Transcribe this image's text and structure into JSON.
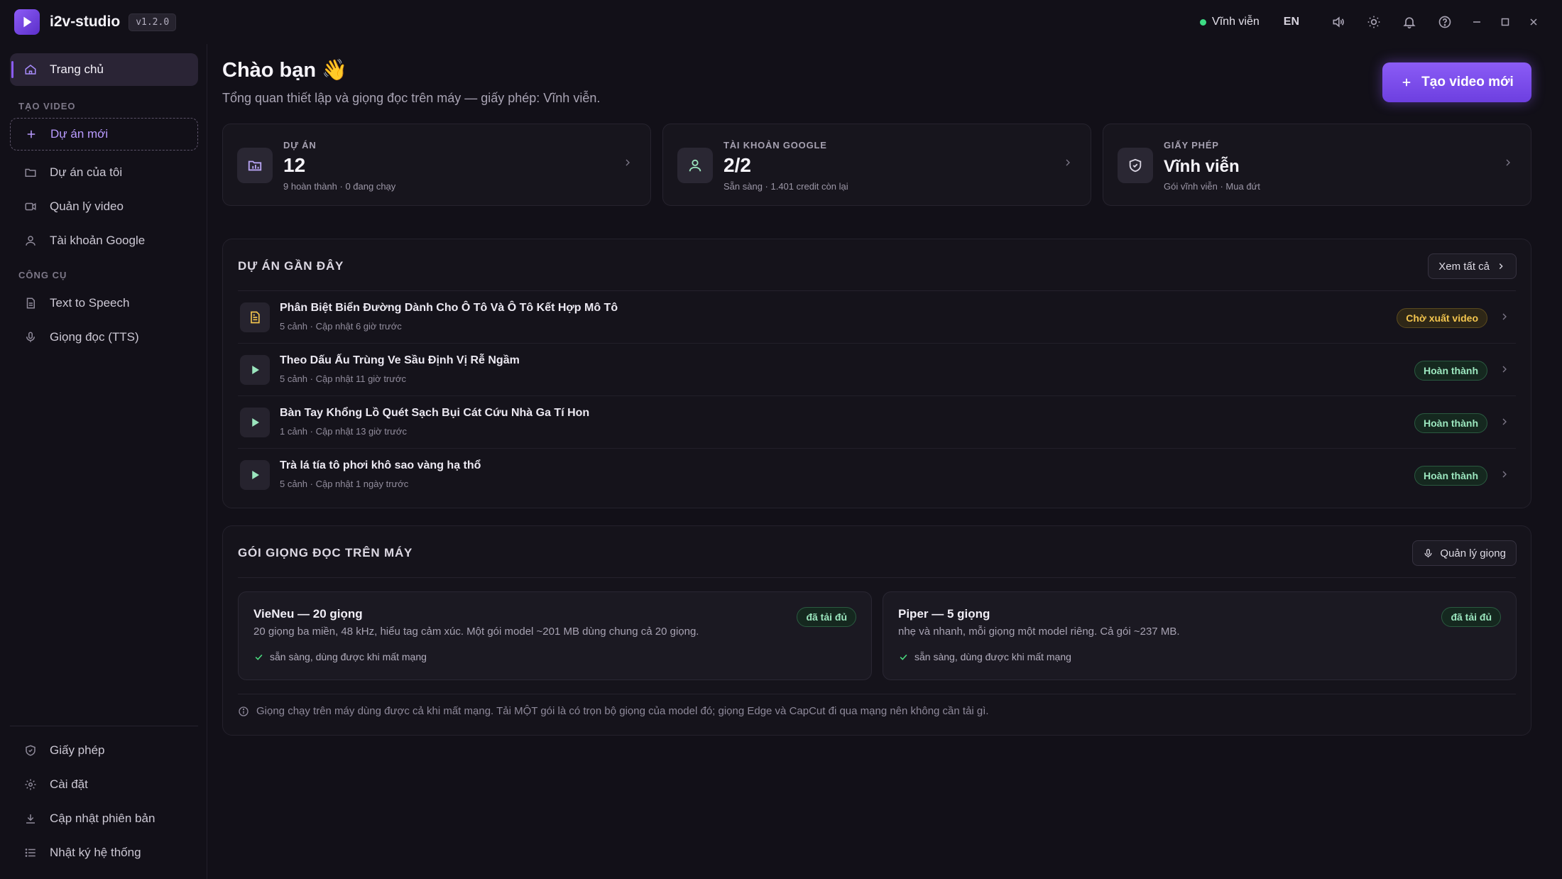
{
  "app": {
    "name": "i2v-studio",
    "version": "v1.2.0"
  },
  "titlebar": {
    "license_status": "Vĩnh viễn",
    "language": "EN",
    "icons": [
      "volume-icon",
      "theme-icon",
      "bell-icon",
      "help-icon",
      "minimize-icon",
      "maximize-icon",
      "close-icon"
    ]
  },
  "sidebar": {
    "home": "Trang chủ",
    "section_create": "TẠO VIDEO",
    "new_project": "Dự án mới",
    "my_projects": "Dự án của tôi",
    "manage_video": "Quản lý video",
    "google_account": "Tài khoản Google",
    "section_tools": "CÔNG CỤ",
    "text_to_speech": "Text to Speech",
    "tts_voice": "Giọng đọc (TTS)",
    "license": "Giấy phép",
    "settings": "Cài đặt",
    "update": "Cập nhật phiên bản",
    "system_log": "Nhật ký hệ thống"
  },
  "main": {
    "greeting": "Chào bạn 👋",
    "subtitle": "Tổng quan thiết lập và giọng đọc trên máy — giấy phép: Vĩnh viễn.",
    "new_video_button": "Tạo video mới",
    "stats": [
      {
        "label": "DỰ ÁN",
        "value": "12",
        "sub": "9 hoàn thành · 0 đang chạy",
        "icon": "folder-icon"
      },
      {
        "label": "TÀI KHOẢN GOOGLE",
        "value": "2/2",
        "sub": "Sẵn sàng · 1.401 credit còn lại",
        "icon": "user-icon"
      },
      {
        "label": "GIẤY PHÉP",
        "value": "Vĩnh viễn",
        "sub": "Gói vĩnh viễn · Mua đứt",
        "icon": "shield-icon"
      }
    ],
    "recent": {
      "title": "DỰ ÁN GẦN ĐÂY",
      "view_all": "Xem tất cả",
      "items": [
        {
          "title": "Phân Biệt Biển Đường Dành Cho Ô Tô Và Ô Tô Kết Hợp Mô Tô",
          "meta": "5 cảnh · Cập nhật 6 giờ trước",
          "status": "Chờ xuất video",
          "icon": "document-icon"
        },
        {
          "title": "Theo Dấu Ấu Trùng Ve Sầu Định Vị Rễ Ngầm",
          "meta": "5 cảnh · Cập nhật 11 giờ trước",
          "status": "Hoàn thành",
          "icon": "play-icon"
        },
        {
          "title": "Bàn Tay Khổng Lồ Quét Sạch Bụi Cát Cứu Nhà Ga Tí Hon",
          "meta": "1 cảnh · Cập nhật 13 giờ trước",
          "status": "Hoàn thành",
          "icon": "play-icon"
        },
        {
          "title": "Trà lá tía tô phơi khô sao vàng hạ thổ",
          "meta": "5 cảnh · Cập nhật 1 ngày trước",
          "status": "Hoàn thành",
          "icon": "play-icon"
        }
      ]
    },
    "voices": {
      "title": "GÓI GIỌNG ĐỌC TRÊN MÁY",
      "manage": "Quản lý giọng",
      "packs": [
        {
          "name": "VieNeu — 20 giọng",
          "desc": "20 giọng ba miền, 48 kHz, hiểu tag cảm xúc. Một gói model ~201 MB dùng chung cả 20 giọng.",
          "ready": "sẵn sàng, dùng được khi mất mạng",
          "badge": "đã tải đủ"
        },
        {
          "name": "Piper — 5 giọng",
          "desc": "nhẹ và nhanh, mỗi giọng một model riêng. Cả gói ~237 MB.",
          "ready": "sẵn sàng, dùng được khi mất mạng",
          "badge": "đã tải đủ"
        }
      ],
      "note": "Giọng chạy trên máy dùng được cả khi mất mạng. Tải MỘT gói là có trọn bộ giọng của model đó; giọng Edge và CapCut đi qua mạng nên không cần tải gì."
    }
  },
  "colors": {
    "accent": "#8b5cf6",
    "background": "#121018",
    "status_done": "#9be6be",
    "status_wait": "#f3c54e",
    "online_dot": "#3ddc84"
  }
}
